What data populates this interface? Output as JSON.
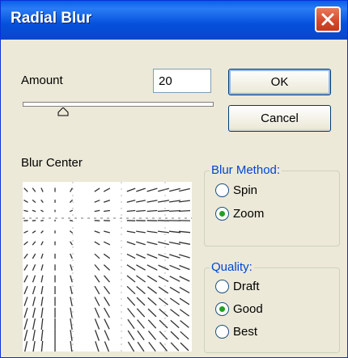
{
  "window": {
    "title": "Radial Blur"
  },
  "amount": {
    "label": "Amount",
    "value": "20",
    "slider_fraction": 0.2
  },
  "buttons": {
    "ok": "OK",
    "cancel": "Cancel"
  },
  "preview": {
    "label": "Blur Center"
  },
  "blur_method": {
    "title": "Blur Method:",
    "options": [
      {
        "label": "Spin",
        "selected": false
      },
      {
        "label": "Zoom",
        "selected": true
      }
    ]
  },
  "quality": {
    "title": "Quality:",
    "options": [
      {
        "label": "Draft",
        "selected": false
      },
      {
        "label": "Good",
        "selected": true
      },
      {
        "label": "Best",
        "selected": false
      }
    ]
  },
  "colors": {
    "title_bar": "#0a5fe8",
    "group_title": "#0046d5",
    "radio_dot": "#21a121",
    "close_button": "#d4472a"
  }
}
